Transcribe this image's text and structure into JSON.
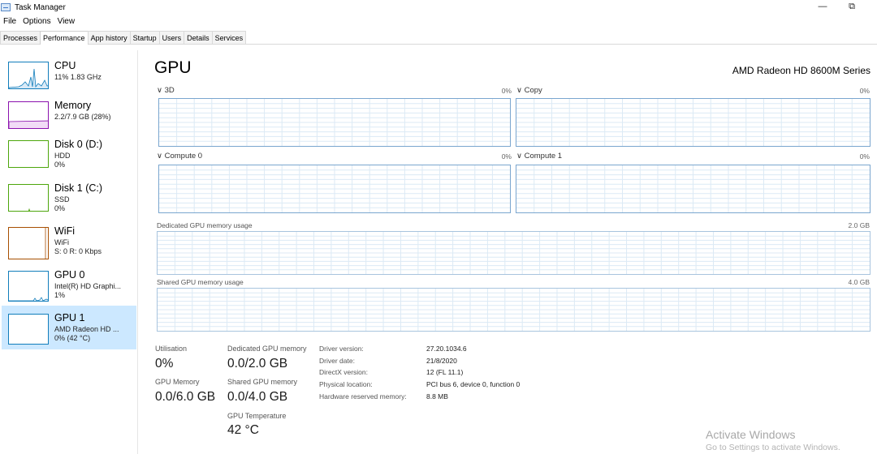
{
  "window": {
    "title": "Task Manager",
    "minimize_glyph": "—",
    "maximize_glyph": "⧉"
  },
  "menu": [
    "File",
    "Options",
    "View"
  ],
  "tabs": [
    "Processes",
    "Performance",
    "App history",
    "Startup",
    "Users",
    "Details",
    "Services"
  ],
  "active_tab": "Performance",
  "sidebar": [
    {
      "title": "CPU",
      "lines": [
        "11%  1.83 GHz"
      ],
      "color": "#117dbb"
    },
    {
      "title": "Memory",
      "lines": [
        "2.2/7.9 GB (28%)"
      ],
      "color": "#8b12ae"
    },
    {
      "title": "Disk 0 (D:)",
      "lines": [
        "HDD",
        "0%"
      ],
      "color": "#4da60c"
    },
    {
      "title": "Disk 1 (C:)",
      "lines": [
        "SSD",
        "0%"
      ],
      "color": "#4da60c"
    },
    {
      "title": "WiFi",
      "lines": [
        "WiFi",
        "S: 0  R: 0 Kbps"
      ],
      "color": "#a74f01"
    },
    {
      "title": "GPU 0",
      "lines": [
        "Intel(R) HD Graphi...",
        "1%"
      ],
      "color": "#117dbb"
    },
    {
      "title": "GPU 1",
      "lines": [
        "AMD Radeon HD ...",
        "0% (42 °C)"
      ],
      "color": "#117dbb"
    }
  ],
  "selected_index": 6,
  "main": {
    "title": "GPU",
    "model": "AMD Radeon HD 8600M Series",
    "engines": [
      {
        "name": "3D",
        "value": "0%"
      },
      {
        "name": "Copy",
        "value": "0%"
      },
      {
        "name": "Compute 0",
        "value": "0%"
      },
      {
        "name": "Compute 1",
        "value": "0%"
      }
    ],
    "dedicated_chart": {
      "label": "Dedicated GPU memory usage",
      "max": "2.0 GB"
    },
    "shared_chart": {
      "label": "Shared GPU memory usage",
      "max": "4.0 GB"
    },
    "stats": {
      "utilisation": {
        "label": "Utilisation",
        "value": "0%"
      },
      "gpu_memory": {
        "label": "GPU Memory",
        "value": "0.0/6.0 GB"
      },
      "dedicated": {
        "label": "Dedicated GPU memory",
        "value": "0.0/2.0 GB"
      },
      "shared": {
        "label": "Shared GPU memory",
        "value": "0.0/4.0 GB"
      },
      "temperature": {
        "label": "GPU Temperature",
        "value": "42 °C"
      }
    },
    "info": [
      {
        "key": "Driver version:",
        "value": "27.20.1034.6"
      },
      {
        "key": "Driver date:",
        "value": "21/8/2020"
      },
      {
        "key": "DirectX version:",
        "value": "12 (FL 11.1)"
      },
      {
        "key": "Physical location:",
        "value": "PCI bus 6, device 0, function 0"
      },
      {
        "key": "Hardware reserved memory:",
        "value": "8.8 MB"
      }
    ]
  },
  "watermark": {
    "title": "Activate Windows",
    "subtitle": "Go to Settings to activate Windows."
  },
  "colors": {
    "chart_border": "#7aa6cf",
    "grid": "#dceaf5",
    "selected_bg": "#cce8ff"
  },
  "icons": {
    "app": "task-manager-icon",
    "expand": "chevron-down-icon"
  }
}
